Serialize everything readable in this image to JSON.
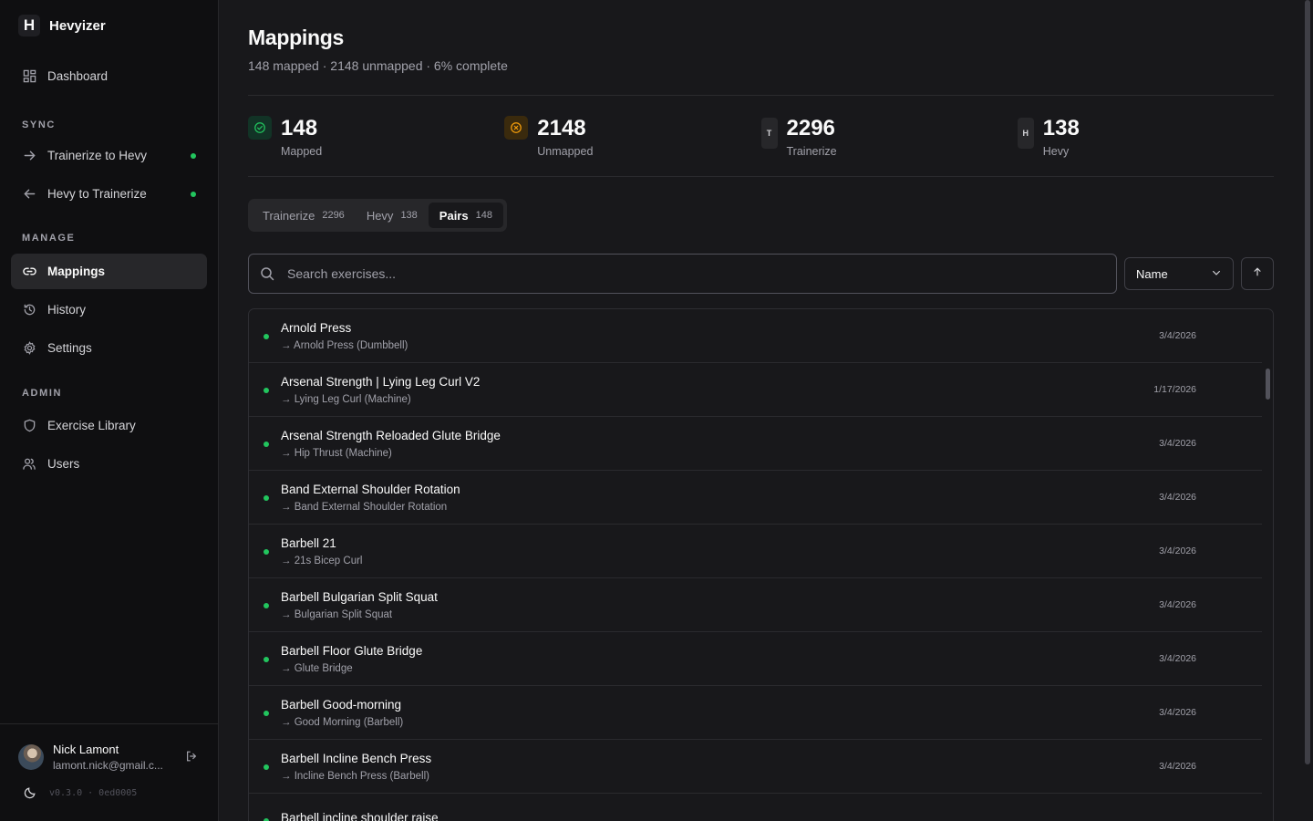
{
  "brand": {
    "mark": "H",
    "name": "Hevyizer"
  },
  "nav": {
    "dashboard": "Dashboard",
    "sync_title": "SYNC",
    "sync_items": [
      "Trainerize to Hevy",
      "Hevy to Trainerize"
    ],
    "manage_title": "MANAGE",
    "manage_items": [
      "Mappings",
      "History",
      "Settings"
    ],
    "admin_title": "ADMIN",
    "admin_items": [
      "Exercise Library",
      "Users"
    ]
  },
  "user": {
    "name": "Nick Lamont",
    "email": "lamont.nick@gmail.c..."
  },
  "version": "v0.3.0 · 0ed0005",
  "page": {
    "title": "Mappings",
    "subtitle": "148 mapped · 2148 unmapped · 6% complete"
  },
  "stats": [
    {
      "value": "148",
      "label": "Mapped",
      "badge": ""
    },
    {
      "value": "2148",
      "label": "Unmapped",
      "badge": ""
    },
    {
      "value": "2296",
      "label": "Trainerize",
      "badge": "T"
    },
    {
      "value": "138",
      "label": "Hevy",
      "badge": "H"
    }
  ],
  "tabs": [
    {
      "label": "Trainerize",
      "count": "2296"
    },
    {
      "label": "Hevy",
      "count": "138"
    },
    {
      "label": "Pairs",
      "count": "148"
    }
  ],
  "search": {
    "placeholder": "Search exercises..."
  },
  "sort": {
    "field": "Name"
  },
  "rows": [
    {
      "title": "Arnold Press",
      "sub": "→ Arnold Press (Dumbbell)",
      "date": "3/4/2026"
    },
    {
      "title": "Arsenal Strength | Lying Leg Curl V2",
      "sub": "→ Lying Leg Curl (Machine)",
      "date": "1/17/2026"
    },
    {
      "title": "Arsenal Strength Reloaded Glute Bridge",
      "sub": "→ Hip Thrust (Machine)",
      "date": "3/4/2026"
    },
    {
      "title": "Band External Shoulder Rotation",
      "sub": "→ Band External Shoulder Rotation",
      "date": "3/4/2026"
    },
    {
      "title": "Barbell 21",
      "sub": "→ 21s Bicep Curl",
      "date": "3/4/2026"
    },
    {
      "title": "Barbell Bulgarian Split Squat",
      "sub": "→ Bulgarian Split Squat",
      "date": "3/4/2026"
    },
    {
      "title": "Barbell Floor Glute Bridge",
      "sub": "→ Glute Bridge",
      "date": "3/4/2026"
    },
    {
      "title": "Barbell Good-morning",
      "sub": "→ Good Morning (Barbell)",
      "date": "3/4/2026"
    },
    {
      "title": "Barbell Incline Bench Press",
      "sub": "→ Incline Bench Press (Barbell)",
      "date": "3/4/2026"
    },
    {
      "title": "Barbell incline shoulder raise",
      "sub": "",
      "date": ""
    }
  ],
  "colors": {
    "accent_green": "#22c55e",
    "accent_amber": "#f59e0b",
    "bg": "#18181b",
    "sidebar_bg": "#0f0f11"
  }
}
